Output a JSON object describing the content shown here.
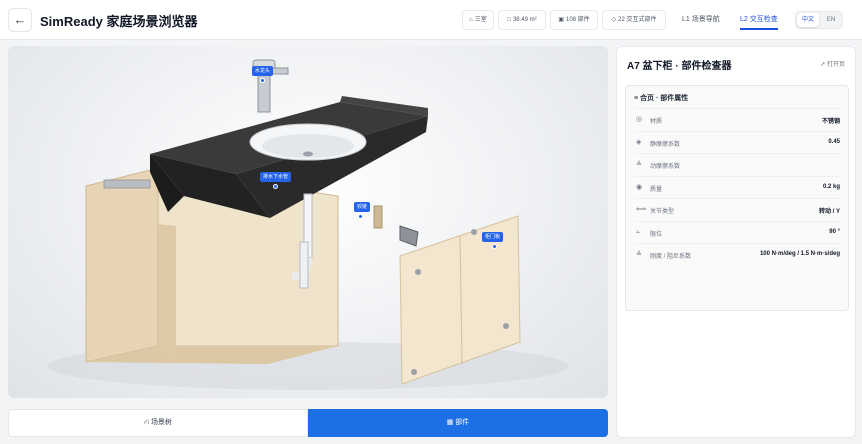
{
  "header": {
    "back_icon": "←",
    "title": "SimReady 家庭场景浏览器",
    "chips": [
      {
        "icon": "⌂",
        "label": "三室"
      },
      {
        "icon": "□",
        "label": "38.49 m²"
      },
      {
        "icon": "▣",
        "label": "108 部件"
      },
      {
        "icon": "◇",
        "label": "22 交互式部件"
      }
    ],
    "levels": [
      {
        "label": "L1 场景导航",
        "active": false
      },
      {
        "label": "L2 交互检查",
        "active": true
      }
    ],
    "lang": {
      "on": "中文",
      "off": "EN"
    }
  },
  "viewer": {
    "labels": {
      "faucet": "水龙头",
      "drain": "排水下水管",
      "hinge": "铰链",
      "door": "柜门板"
    }
  },
  "bottom_bar": {
    "left": {
      "icon": "⛙",
      "label": "场景树"
    },
    "right": {
      "icon": "▦",
      "label": "部件"
    }
  },
  "panel": {
    "title": "A7 盆下柜 · 部件检查器",
    "link": "↗ 打开页",
    "section_title": "≡ 合页 · 部件属性",
    "rows": [
      {
        "icon": "◎",
        "key": "材质",
        "value": "不锈钢"
      },
      {
        "icon": "◈",
        "key": "静摩擦系数",
        "value": "0.45"
      },
      {
        "icon": "≗",
        "key": "动摩擦系数",
        "value": ""
      },
      {
        "icon": "◉",
        "key": "质量",
        "value": "0.2 kg"
      },
      {
        "icon": "⟺",
        "key": "关节类型",
        "value": "转动 / Y"
      },
      {
        "icon": "⦣",
        "key": "限位",
        "value": "90 °"
      },
      {
        "icon": "≗",
        "key": "刚度 / 阻尼系数",
        "value": "100 N·m/deg / 1.5 N·m·s/deg"
      }
    ]
  },
  "colors": {
    "accent": "#1d6fe6",
    "label_blue": "#2563eb",
    "countertop": "#2b2b2b",
    "cabinet_wood": "#ecdcc0"
  }
}
